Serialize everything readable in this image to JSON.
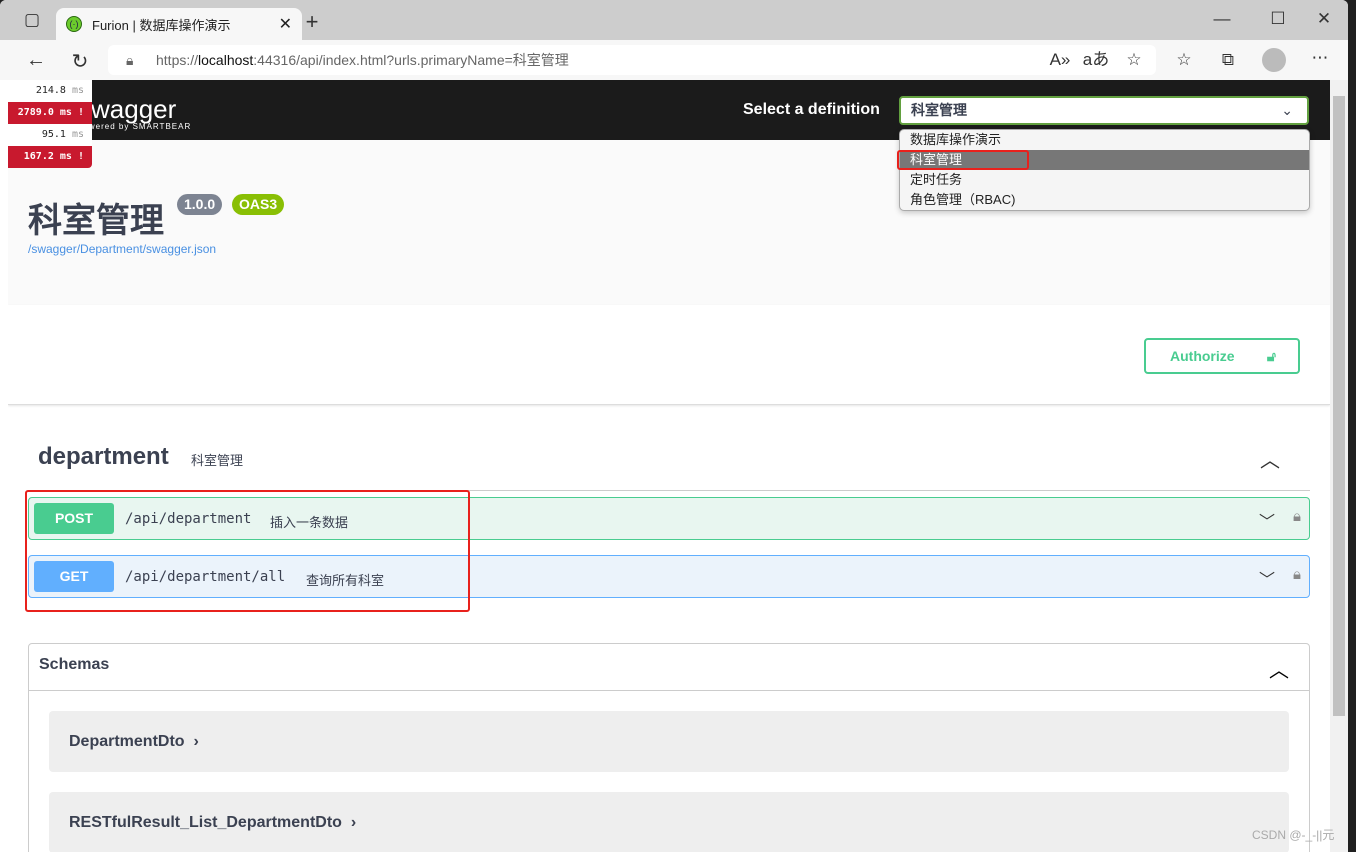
{
  "browser": {
    "tab_title": "Furion | 数据库操作演示",
    "url_prefix": "https://",
    "url_host": "localhost",
    "url_rest": ":44316/api/index.html?urls.primaryName=科室管理"
  },
  "timing": [
    {
      "value": "214.8",
      "unit": "ms",
      "slow": false
    },
    {
      "value": "2789.0",
      "unit": "ms !",
      "slow": true
    },
    {
      "value": "95.1",
      "unit": "ms",
      "slow": false
    },
    {
      "value": "167.2",
      "unit": "ms !",
      "slow": true
    }
  ],
  "topbar": {
    "logo": "swagger",
    "logo_sub": "powered by SMARTBEAR",
    "select_label": "Select a definition",
    "selected": "科室管理",
    "options": [
      "数据库操作演示",
      "科室管理",
      "定时任务",
      "角色管理（RBAC)"
    ]
  },
  "info": {
    "title": "科室管理",
    "version": "1.0.0",
    "oas": "OAS3",
    "json_link": "/swagger/Department/swagger.json"
  },
  "authorize": "Authorize",
  "tag": {
    "name": "department",
    "description": "科室管理"
  },
  "operations": [
    {
      "method": "POST",
      "path": "/api/department",
      "summary": "插入一条数据",
      "color": "#49cc90"
    },
    {
      "method": "GET",
      "path": "/api/department/all",
      "summary": "查询所有科室",
      "color": "#61affe"
    }
  ],
  "schemas": {
    "title": "Schemas",
    "models": [
      "DepartmentDto",
      "RESTfulResult_List_DepartmentDto"
    ]
  },
  "watermark": "CSDN @-_-||元"
}
